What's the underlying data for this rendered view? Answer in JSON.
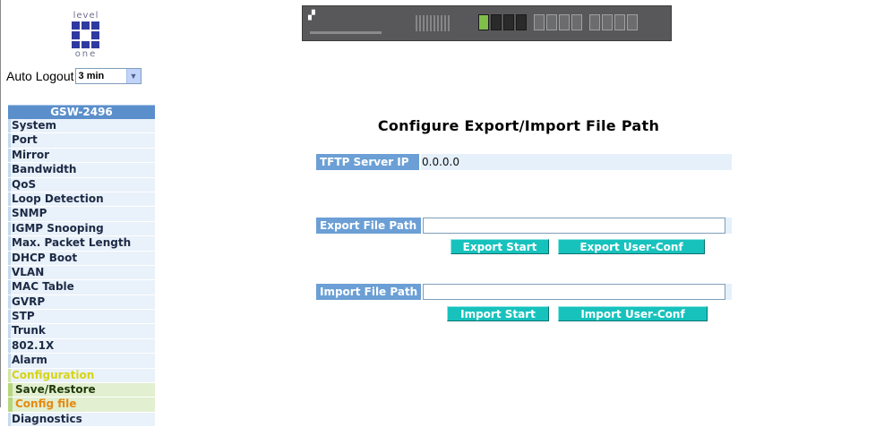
{
  "logo": {
    "top_text": "level",
    "bottom_text": "one"
  },
  "auto_logout": {
    "label": "Auto Logout",
    "value": "3 min"
  },
  "menu": {
    "header": "GSW-2496",
    "items": [
      "System",
      "Port",
      "Mirror",
      "Bandwidth",
      "QoS",
      "Loop Detection",
      "SNMP",
      "IGMP Snooping",
      "Max. Packet Length",
      "DHCP Boot",
      "VLAN",
      "MAC Table",
      "GVRP",
      "STP",
      "Trunk",
      "802.1X",
      "Alarm"
    ],
    "configuration": "Configuration",
    "sub_items": [
      "Save/Restore",
      "Config file"
    ],
    "last_item": "Diagnostics"
  },
  "page": {
    "title": "Configure Export/Import File Path",
    "tftp": {
      "label": "TFTP Server IP",
      "value": "0.0.0.0"
    },
    "export": {
      "label": "Export File Path",
      "value": "",
      "start_button": "Export Start",
      "user_conf_button": "Export User-Conf"
    },
    "import": {
      "label": "Import File Path",
      "value": "",
      "start_button": "Import Start",
      "user_conf_button": "Import User-Conf"
    }
  },
  "colors": {
    "menu_header": "#5b8fcb",
    "label_bg": "#6b9fd5",
    "button_bg": "#17c2bd",
    "active_item": "#e58a12"
  }
}
